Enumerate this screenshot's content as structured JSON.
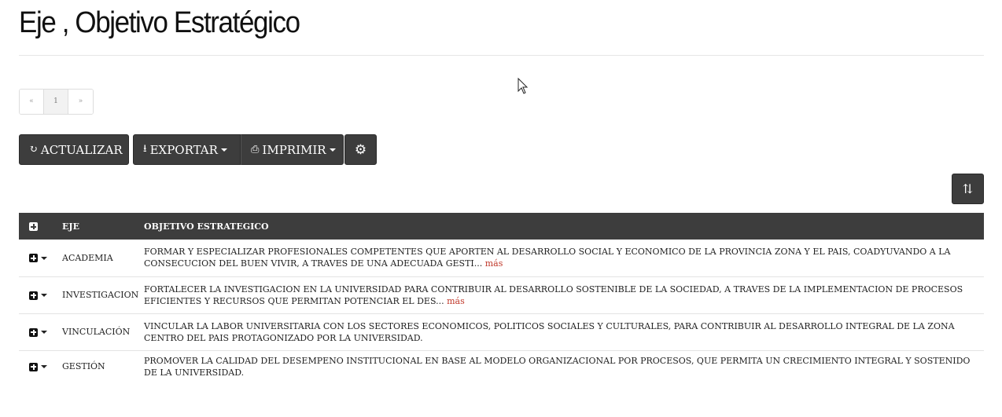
{
  "page": {
    "title": "Eje , Objetivo Estratégico"
  },
  "pagination": {
    "prev": "«",
    "current": "1",
    "next": "»"
  },
  "toolbar": {
    "refresh_label": "ACTUALIZAR",
    "export_label": "EXPORTAR",
    "print_label": "IMPRIMIR",
    "icons": [
      "refresh-icon",
      "export-icon",
      "print-icon",
      "gear-icon",
      "sort-icon"
    ]
  },
  "table": {
    "columns": [
      "EJE",
      "OBJETIVO ESTRATEGICO"
    ],
    "more_label": "más",
    "rows": [
      {
        "eje": "ACADEMIA",
        "objetivo": "FORMAR Y ESPECIALIZAR PROFESIONALES COMPETENTES QUE APORTEN AL DESARROLLO SOCIAL Y ECONOMICO DE LA PROVINCIA ZONA Y EL PAIS, COADYUVANDO A LA CONSECUCION DEL BUEN VIVIR, A TRAVES DE UNA ADECUADA GESTI...",
        "truncated": true
      },
      {
        "eje": "INVESTIGACION",
        "objetivo": "FORTALECER LA INVESTIGACION EN LA UNIVERSIDAD PARA CONTRIBUIR AL DESARROLLO SOSTENIBLE DE LA SOCIEDAD, A TRAVES DE LA IMPLEMENTACION DE PROCESOS EFICIENTES Y RECURSOS QUE PERMITAN POTENCIAR EL DES...",
        "truncated": true
      },
      {
        "eje": "VINCULACIÓN",
        "objetivo": "VINCULAR LA LABOR UNIVERSITARIA CON LOS SECTORES ECONOMICOS, POLITICOS SOCIALES Y CULTURALES, PARA CONTRIBUIR AL DESARROLLO INTEGRAL DE LA ZONA CENTRO DEL PAIS PROTAGONIZADO POR LA UNIVERSIDAD.",
        "truncated": false
      },
      {
        "eje": "GESTIÓN",
        "objetivo": "PROMOVER LA CALIDAD DEL DESEMPENO INSTITUCIONAL EN BASE AL MODELO ORGANIZACIONAL POR PROCESOS, QUE PERMITA UN CRECIMIENTO INTEGRAL Y SOSTENIDO DE LA UNIVERSIDAD.",
        "truncated": false
      }
    ]
  },
  "colors": {
    "dark": "#3d3d3d",
    "link": "#c0392b",
    "rule": "#e6e6e6"
  }
}
